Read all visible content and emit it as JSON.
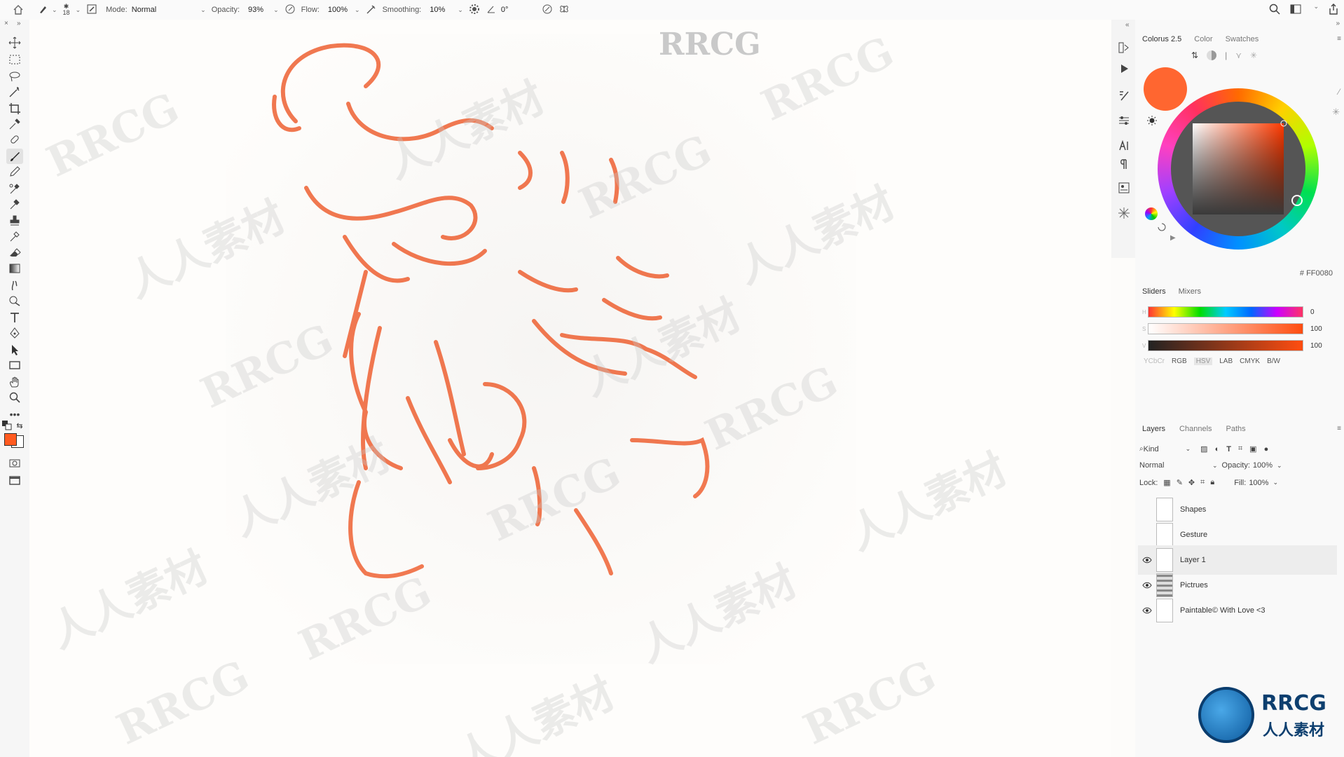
{
  "options_bar": {
    "brush_size": "18",
    "mode_label": "Mode:",
    "mode_value": "Normal",
    "opacity_label": "Opacity:",
    "opacity_value": "93%",
    "flow_label": "Flow:",
    "flow_value": "100%",
    "smoothing_label": "Smoothing:",
    "smoothing_value": "10%",
    "angle_value": "0°"
  },
  "watermark": {
    "top_text": "RRCG",
    "latin_text": "RRCG",
    "cjk_text": "人人素材"
  },
  "color_panel": {
    "tabs": [
      "Colorus 2.5",
      "Color",
      "Swatches"
    ],
    "current_color": "#ff6630",
    "hex_value": "# FF0080",
    "subtabs": [
      "Sliders",
      "Mixers"
    ],
    "sliders": [
      {
        "label": "H",
        "value": "0"
      },
      {
        "label": "S",
        "value": "100"
      },
      {
        "label": "V",
        "value": "100"
      }
    ],
    "models": [
      "YCbCr",
      "RGB",
      "HSV",
      "LAB",
      "CMYK",
      "B/W"
    ]
  },
  "layers_panel": {
    "tabs": [
      "Layers",
      "Channels",
      "Paths"
    ],
    "kind_label": "Kind",
    "blend_mode": "Normal",
    "opacity_label": "Opacity:",
    "opacity_value": "100%",
    "lock_label": "Lock:",
    "fill_label": "Fill:",
    "fill_value": "100%",
    "layers": [
      {
        "name": "Shapes",
        "visible": false,
        "selected": false
      },
      {
        "name": "Gesture",
        "visible": false,
        "selected": false
      },
      {
        "name": "Layer 1",
        "visible": true,
        "selected": true
      },
      {
        "name": "Pictrues",
        "visible": true,
        "selected": false
      },
      {
        "name": "Paintable© With Love <3",
        "visible": true,
        "selected": false
      }
    ]
  },
  "logo": {
    "text": "RRCG",
    "sub": "人人素材"
  }
}
